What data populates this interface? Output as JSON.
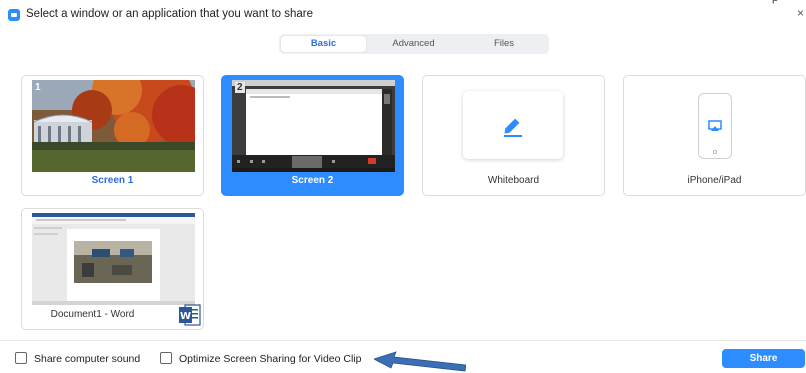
{
  "window": {
    "title": "Select a window or an application that you want to share",
    "close_glyph": "×",
    "corner_glyph": "p"
  },
  "tabs": [
    {
      "label": "Basic",
      "active": true
    },
    {
      "label": "Advanced",
      "active": false
    },
    {
      "label": "Files",
      "active": false
    }
  ],
  "cards": {
    "screen1": {
      "label": "Screen 1",
      "number": "1"
    },
    "screen2": {
      "label": "Screen 2",
      "number": "2",
      "selected": true
    },
    "whiteboard": {
      "label": "Whiteboard",
      "icon": "pencil-icon"
    },
    "iphone": {
      "label": "iPhone/iPad",
      "icon": "airplay-icon"
    },
    "document1": {
      "label": "Document1 - Word",
      "icon": "word-icon",
      "icon_letter": "W"
    }
  },
  "options": {
    "share_sound": {
      "label": "Share computer sound",
      "checked": false
    },
    "optimize_video": {
      "label": "Optimize Screen Sharing for Video Clip",
      "checked": false
    }
  },
  "share_button": {
    "label": "Share"
  },
  "colors": {
    "accent": "#2d8cff",
    "tab_active_text": "#2d6cdf",
    "arrow": "#3a6fb8"
  }
}
